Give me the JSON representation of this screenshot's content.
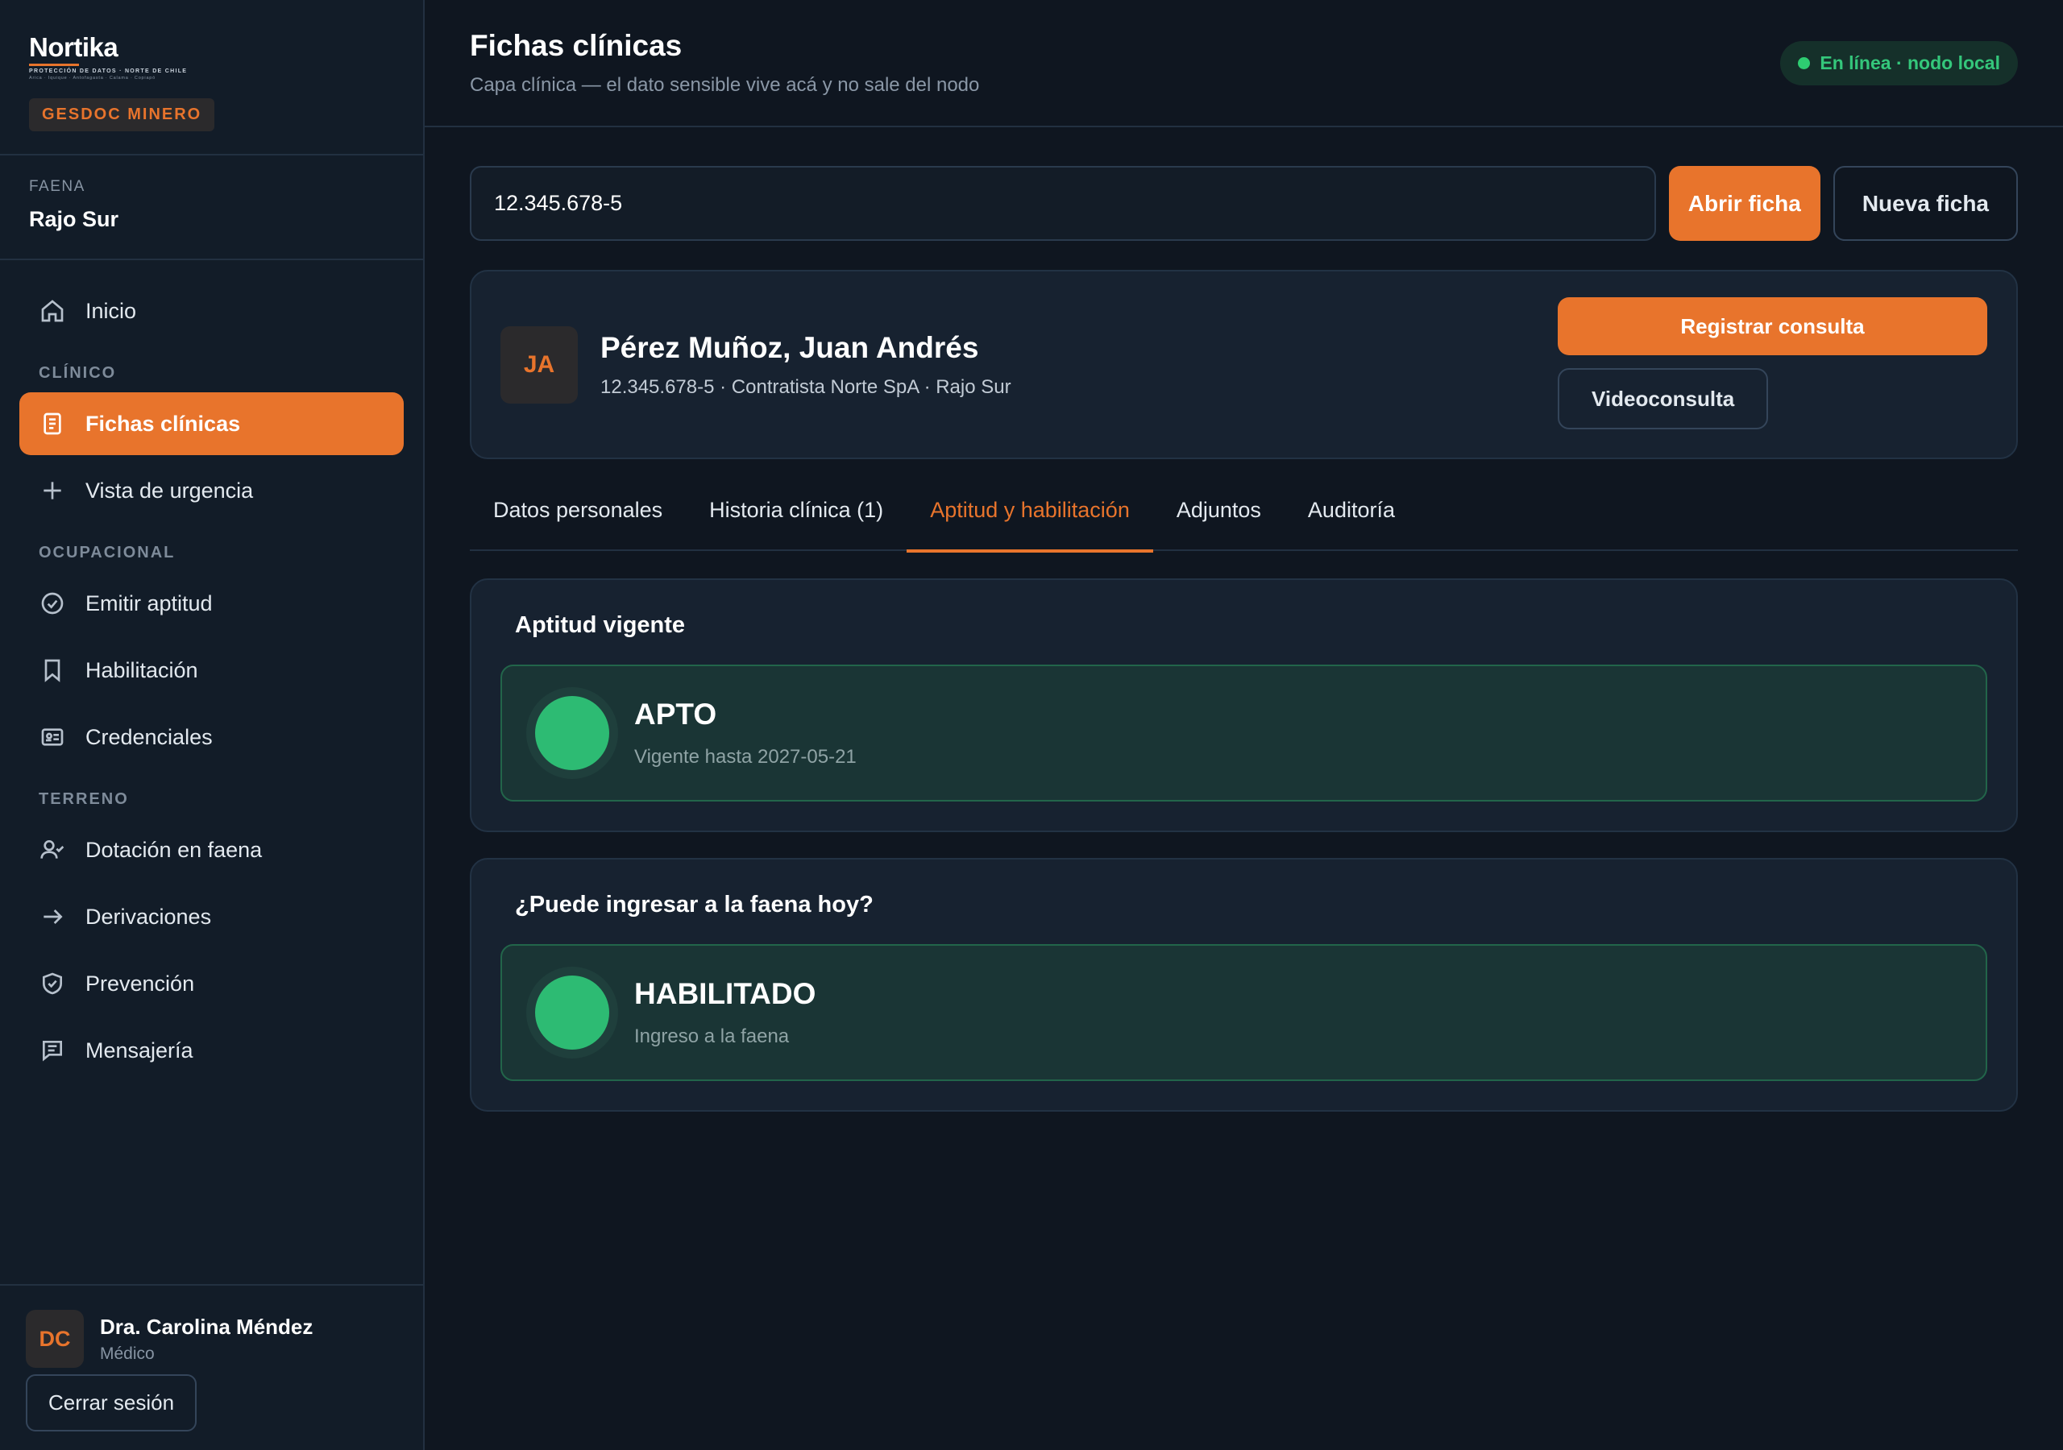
{
  "brand": {
    "logo": "Nortika",
    "tagline": "PROTECCIÓN DE DATOS · NORTE DE CHILE",
    "cities": "Arica · Iquique · Antofagasta · Calama · Copiapó",
    "badge": "GESDOC MINERO"
  },
  "faena": {
    "label": "FAENA",
    "name": "Rajo Sur"
  },
  "sidebar": {
    "items": [
      {
        "label": "Inicio",
        "icon": "home-icon"
      },
      {
        "section": "CLÍNICO"
      },
      {
        "label": "Fichas clínicas",
        "icon": "document-icon",
        "active": true
      },
      {
        "label": "Vista de urgencia",
        "icon": "plus-icon"
      },
      {
        "section": "OCUPACIONAL"
      },
      {
        "label": "Emitir aptitud",
        "icon": "check-circle-icon"
      },
      {
        "label": "Habilitación",
        "icon": "bookmark-icon"
      },
      {
        "label": "Credenciales",
        "icon": "id-card-icon"
      },
      {
        "section": "TERRENO"
      },
      {
        "label": "Dotación en faena",
        "icon": "user-check-icon"
      },
      {
        "label": "Derivaciones",
        "icon": "arrow-right-icon"
      },
      {
        "label": "Prevención",
        "icon": "shield-check-icon"
      },
      {
        "label": "Mensajería",
        "icon": "message-icon"
      }
    ]
  },
  "user": {
    "initials": "DC",
    "name": "Dra. Carolina Méndez",
    "role": "Médico",
    "logout_label": "Cerrar sesión"
  },
  "header": {
    "title": "Fichas clínicas",
    "subtitle": "Capa clínica — el dato sensible vive acá y no sale del nodo",
    "status": "En línea · nodo local"
  },
  "search": {
    "value": "12.345.678-5",
    "open_label": "Abrir ficha",
    "new_label": "Nueva ficha"
  },
  "patient": {
    "initials": "JA",
    "name": "Pérez Muñoz, Juan Andrés",
    "meta": "12.345.678-5 · Contratista Norte SpA · Rajo Sur",
    "consult_label": "Registrar consulta",
    "video_label": "Videoconsulta"
  },
  "tabs": [
    {
      "label": "Datos personales"
    },
    {
      "label": "Historia clínica (1)"
    },
    {
      "label": "Aptitud y habilitación",
      "active": true
    },
    {
      "label": "Adjuntos"
    },
    {
      "label": "Auditoría"
    }
  ],
  "aptitud": {
    "title": "Aptitud vigente",
    "status": "APTO",
    "detail": "Vigente hasta 2027-05-21",
    "color": "#2dbb73"
  },
  "habilitacion": {
    "title": "¿Puede ingresar a la faena hoy?",
    "status": "HABILITADO",
    "detail": "Ingreso a la faena",
    "color": "#2dbb73"
  },
  "colors": {
    "accent": "#e8742c",
    "success": "#2dbb73",
    "background": "#0f1620"
  }
}
